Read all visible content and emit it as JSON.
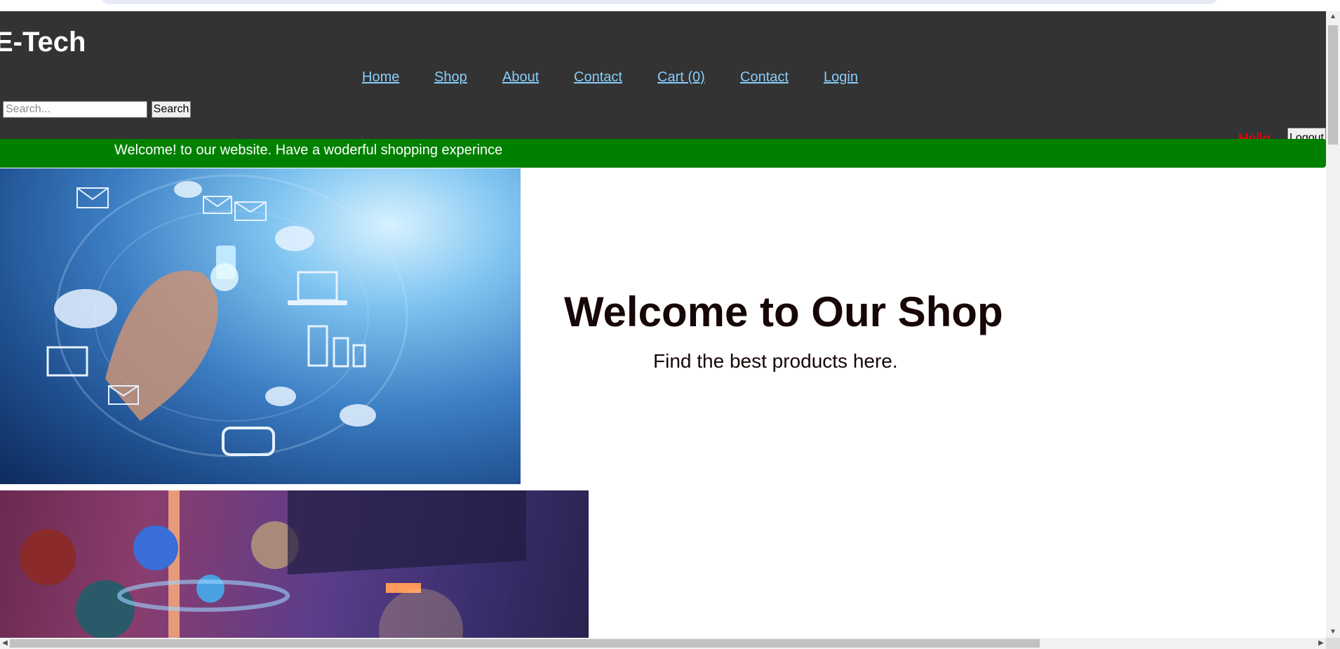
{
  "header": {
    "brand": "E-Tech",
    "nav": [
      {
        "label": "Home"
      },
      {
        "label": "Shop"
      },
      {
        "label": "About"
      },
      {
        "label": "Contact"
      },
      {
        "label": "Cart (0)"
      },
      {
        "label": "Contact"
      },
      {
        "label": "Login"
      }
    ],
    "search": {
      "placeholder": "Search...",
      "value": "",
      "button_label": "Search"
    },
    "user": {
      "greeting": "Hello",
      "logout_label": "Logout"
    }
  },
  "banner": {
    "text": "Welcome! to our website. Have a woderful shopping experince"
  },
  "hero": {
    "title": "Welcome to Our Shop",
    "subtitle": "Find the best products here."
  },
  "scrollbars": {
    "up_icon": "arrow-up-icon",
    "down_icon": "arrow-down-icon",
    "left_icon": "arrow-left-icon",
    "right_icon": "arrow-right-icon"
  },
  "colors": {
    "header_bg": "#333333",
    "nav_link": "#87cefa",
    "banner_bg": "#008000",
    "greeting": "#ff0000",
    "hero_text": "#160606"
  }
}
